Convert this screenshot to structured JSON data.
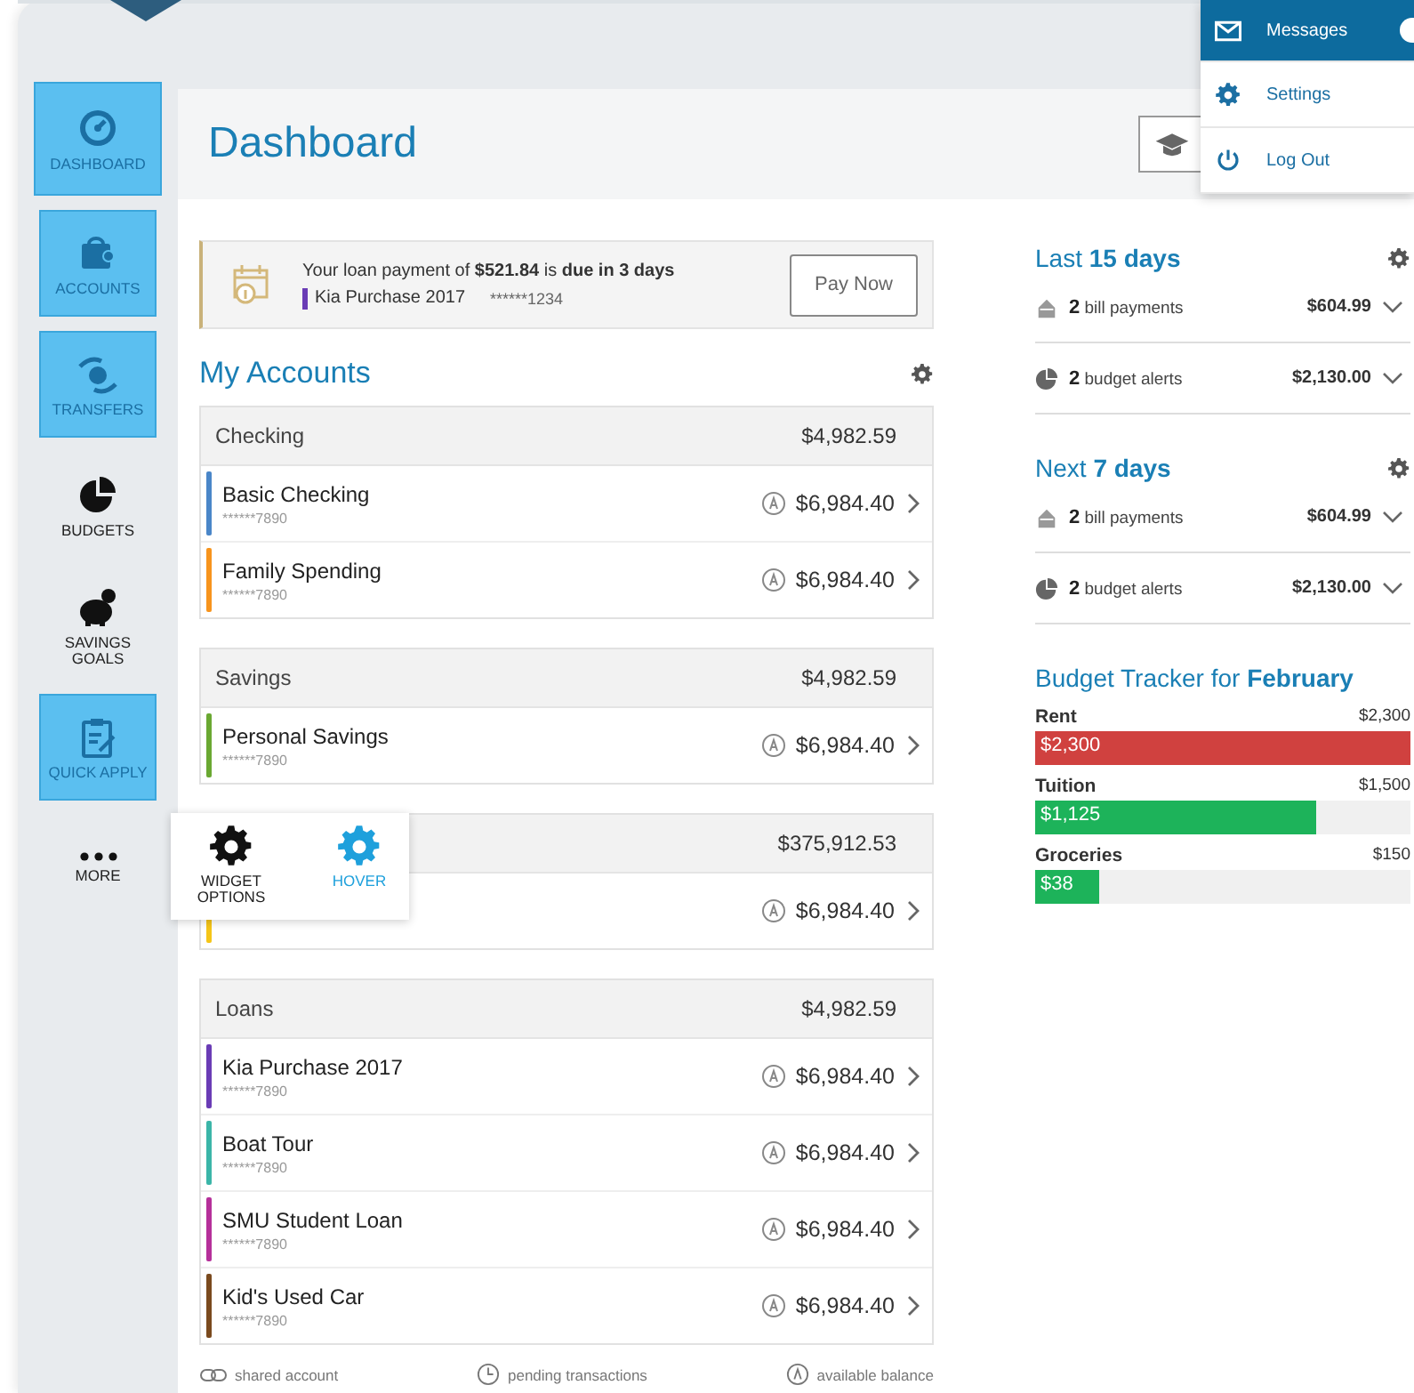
{
  "sidebar": {
    "items": [
      {
        "label": "DASHBOARD",
        "highlighted": true,
        "selected": true
      },
      {
        "label": "ACCOUNTS",
        "highlighted": true,
        "selected": false
      },
      {
        "label": "TRANSFERS",
        "highlighted": true,
        "selected": false
      },
      {
        "label": "BUDGETS",
        "highlighted": false,
        "selected": false
      },
      {
        "label": "SAVINGS GOALS",
        "highlighted": false,
        "selected": false
      },
      {
        "label": "QUICK APPLY",
        "highlighted": true,
        "selected": false
      },
      {
        "label": "MORE",
        "highlighted": false,
        "selected": false
      }
    ]
  },
  "popover": {
    "items": [
      {
        "label": "WIDGET OPTIONS",
        "hover": false
      },
      {
        "label": "HOVER",
        "hover": true
      }
    ]
  },
  "user_menu": {
    "items": [
      {
        "label": "Messages",
        "selected": true
      },
      {
        "label": "Settings",
        "selected": false
      },
      {
        "label": "Log Out",
        "selected": false
      }
    ]
  },
  "header": {
    "title": "Dashboard"
  },
  "alert": {
    "message": "Your loan payment of **$521.84** is **due in 3 days**",
    "account": "Kia Purchase 2017",
    "number": "******1234",
    "button": "Pay Now"
  },
  "accounts": {
    "title": "My Accounts",
    "groups": [
      {
        "label": "Checking",
        "total": "$4,982.59",
        "rows": [
          {
            "name": "Basic Checking",
            "number": "******7890",
            "balance": "$6,984.40",
            "color": "#4a86c8"
          },
          {
            "name": "Family Spending",
            "number": "******7890",
            "balance": "$6,984.40",
            "color": "#f7941d"
          }
        ]
      },
      {
        "label": "Savings",
        "total": "$4,982.59",
        "rows": [
          {
            "name": "Personal Savings",
            "number": "******7890",
            "balance": "$6,984.40",
            "color": "#6aa832"
          }
        ]
      },
      {
        "total": "$375,912.53",
        "rows": [
          {
            "balance": "$6,984.40",
            "color": "#f5c518"
          }
        ]
      },
      {
        "label": "Loans",
        "total": "$4,982.59",
        "rows": [
          {
            "name": "Kia Purchase 2017",
            "number": "******7890",
            "balance": "$6,984.40",
            "color": "#6a3cb5"
          },
          {
            "name": "Boat Tour",
            "number": "******7890",
            "balance": "$6,984.40",
            "color": "#3bb5a8"
          },
          {
            "name": "SMU Student Loan",
            "number": "******7890",
            "balance": "$6,984.40",
            "color": "#b5309a"
          },
          {
            "name": "Kid's Used Car",
            "number": "******7890",
            "balance": "$6,984.40",
            "color": "#7a4a1e"
          }
        ]
      }
    ],
    "legend": [
      "shared account",
      "pending transactions",
      "available balance"
    ]
  },
  "summaries": [
    {
      "title": "Last **15 days**",
      "rows": [
        {
          "text": "**2** bill payments",
          "amount": "$604.99"
        },
        {
          "text": "**2** budget alerts",
          "amount": "$2,130.00"
        }
      ]
    },
    {
      "title": "Next **7 days**",
      "rows": [
        {
          "text": "**2** bill payments",
          "amount": "$604.99"
        },
        {
          "text": "**2** budget alerts",
          "amount": "$2,130.00"
        }
      ]
    }
  ],
  "budget_tracker": {
    "title": "Budget Tracker for **February**",
    "items": [
      {
        "name": "Rent",
        "limit": "$2,300",
        "spent": "$2,300",
        "level": 1.0,
        "color": "#d0413f"
      },
      {
        "name": "Tuition",
        "limit": "$1,500",
        "spent": "$1,125",
        "level": 0.75,
        "color": "#1db35a"
      },
      {
        "name": "Groceries",
        "limit": "$150",
        "spent": "$38",
        "level": 0.17,
        "color": "#1db35a"
      }
    ]
  }
}
